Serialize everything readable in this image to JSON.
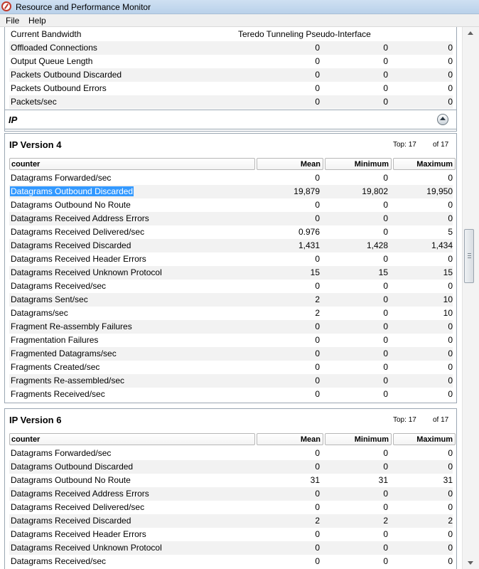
{
  "window": {
    "title": "Resource and Performance Monitor"
  },
  "menu": {
    "file": "File",
    "help": "Help"
  },
  "top_section": {
    "partial_row": {
      "label": "Current Bandwidth",
      "value": "Teredo Tunneling Pseudo-Interface"
    },
    "rows": [
      {
        "label": "Offloaded Connections",
        "mean": "0",
        "min": "0",
        "max": "0"
      },
      {
        "label": "Output Queue Length",
        "mean": "0",
        "min": "0",
        "max": "0"
      },
      {
        "label": "Packets Outbound Discarded",
        "mean": "0",
        "min": "0",
        "max": "0"
      },
      {
        "label": "Packets Outbound Errors",
        "mean": "0",
        "min": "0",
        "max": "0"
      },
      {
        "label": "Packets/sec",
        "mean": "0",
        "min": "0",
        "max": "0"
      }
    ]
  },
  "ip_section": {
    "title": "IP"
  },
  "ipv4": {
    "title": "IP Version 4",
    "top_label": "Top:",
    "top_value": "17",
    "of_label": "of",
    "of_value": "17",
    "headers": {
      "counter": "counter",
      "mean": "Mean",
      "min": "Minimum",
      "max": "Maximum"
    },
    "rows": [
      {
        "label": "Datagrams Forwarded/sec",
        "mean": "0",
        "min": "0",
        "max": "0"
      },
      {
        "label": "Datagrams Outbound Discarded",
        "mean": "19,879",
        "min": "19,802",
        "max": "19,950"
      },
      {
        "label": "Datagrams Outbound No Route",
        "mean": "0",
        "min": "0",
        "max": "0"
      },
      {
        "label": "Datagrams Received Address Errors",
        "mean": "0",
        "min": "0",
        "max": "0"
      },
      {
        "label": "Datagrams Received Delivered/sec",
        "mean": "0.976",
        "min": "0",
        "max": "5"
      },
      {
        "label": "Datagrams Received Discarded",
        "mean": "1,431",
        "min": "1,428",
        "max": "1,434"
      },
      {
        "label": "Datagrams Received Header Errors",
        "mean": "0",
        "min": "0",
        "max": "0"
      },
      {
        "label": "Datagrams Received Unknown Protocol",
        "mean": "15",
        "min": "15",
        "max": "15"
      },
      {
        "label": "Datagrams Received/sec",
        "mean": "0",
        "min": "0",
        "max": "0"
      },
      {
        "label": "Datagrams Sent/sec",
        "mean": "2",
        "min": "0",
        "max": "10"
      },
      {
        "label": "Datagrams/sec",
        "mean": "2",
        "min": "0",
        "max": "10"
      },
      {
        "label": "Fragment Re-assembly Failures",
        "mean": "0",
        "min": "0",
        "max": "0"
      },
      {
        "label": "Fragmentation Failures",
        "mean": "0",
        "min": "0",
        "max": "0"
      },
      {
        "label": "Fragmented Datagrams/sec",
        "mean": "0",
        "min": "0",
        "max": "0"
      },
      {
        "label": "Fragments Created/sec",
        "mean": "0",
        "min": "0",
        "max": "0"
      },
      {
        "label": "Fragments Re-assembled/sec",
        "mean": "0",
        "min": "0",
        "max": "0"
      },
      {
        "label": "Fragments Received/sec",
        "mean": "0",
        "min": "0",
        "max": "0"
      }
    ]
  },
  "ipv6": {
    "title": "IP Version 6",
    "top_label": "Top:",
    "top_value": "17",
    "of_label": "of",
    "of_value": "17",
    "headers": {
      "counter": "counter",
      "mean": "Mean",
      "min": "Minimum",
      "max": "Maximum"
    },
    "rows": [
      {
        "label": "Datagrams Forwarded/sec",
        "mean": "0",
        "min": "0",
        "max": "0"
      },
      {
        "label": "Datagrams Outbound Discarded",
        "mean": "0",
        "min": "0",
        "max": "0"
      },
      {
        "label": "Datagrams Outbound No Route",
        "mean": "31",
        "min": "31",
        "max": "31"
      },
      {
        "label": "Datagrams Received Address Errors",
        "mean": "0",
        "min": "0",
        "max": "0"
      },
      {
        "label": "Datagrams Received Delivered/sec",
        "mean": "0",
        "min": "0",
        "max": "0"
      },
      {
        "label": "Datagrams Received Discarded",
        "mean": "2",
        "min": "2",
        "max": "2"
      },
      {
        "label": "Datagrams Received Header Errors",
        "mean": "0",
        "min": "0",
        "max": "0"
      },
      {
        "label": "Datagrams Received Unknown Protocol",
        "mean": "0",
        "min": "0",
        "max": "0"
      },
      {
        "label": "Datagrams Received/sec",
        "mean": "0",
        "min": "0",
        "max": "0"
      }
    ]
  }
}
